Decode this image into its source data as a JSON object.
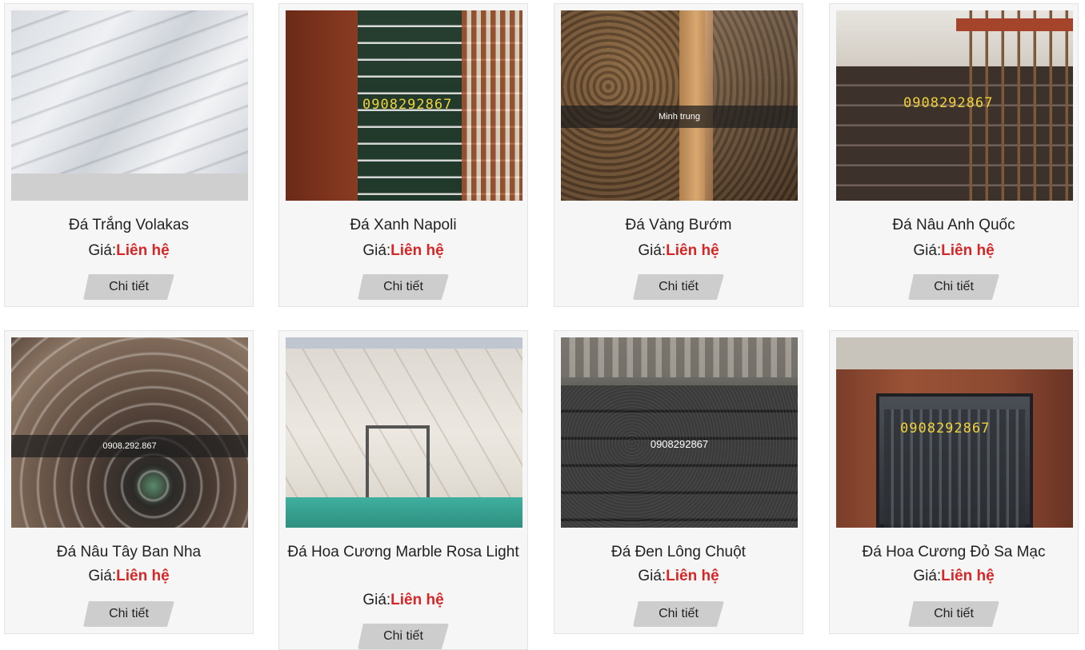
{
  "products": [
    {
      "name": "Đá Trắng Volakas",
      "price_label": "Giá:",
      "price_value": "Liên hệ",
      "button": "Chi tiết",
      "watermark": ""
    },
    {
      "name": "Đá Xanh Napoli",
      "price_label": "Giá:",
      "price_value": "Liên hệ",
      "button": "Chi tiết",
      "watermark": "0908292867"
    },
    {
      "name": "Đá Vàng Bướm",
      "price_label": "Giá:",
      "price_value": "Liên hệ",
      "button": "Chi tiết",
      "watermark": "Minh trung"
    },
    {
      "name": "Đá Nâu Anh Quốc",
      "price_label": "Giá:",
      "price_value": "Liên hệ",
      "button": "Chi tiết",
      "watermark": "0908292867"
    },
    {
      "name": "Đá Nâu Tây Ban Nha",
      "price_label": "Giá:",
      "price_value": "Liên hệ",
      "button": "Chi tiết",
      "watermark": "0908.292.867"
    },
    {
      "name": "Đá Hoa Cương Marble Rosa Light",
      "price_label": "Giá:",
      "price_value": "Liên hệ",
      "button": "Chi tiết",
      "watermark": ""
    },
    {
      "name": "Đá Đen Lông Chuột",
      "price_label": "Giá:",
      "price_value": "Liên hệ",
      "button": "Chi tiết",
      "watermark": "0908292867"
    },
    {
      "name": "Đá Hoa Cương Đỏ Sa Mạc",
      "price_label": "Giá:",
      "price_value": "Liên hệ",
      "button": "Chi tiết",
      "watermark": "0908292867"
    }
  ],
  "colors": {
    "price": "#d62626",
    "button": "#cdcdcd",
    "card": "#f6f6f6"
  }
}
